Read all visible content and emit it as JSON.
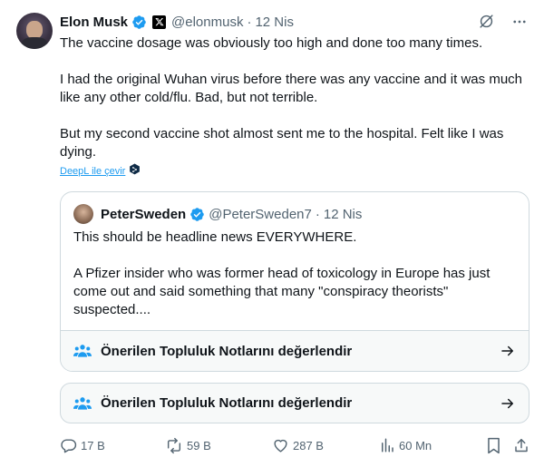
{
  "author": {
    "name": "Elon Musk",
    "handle": "@elonmusk",
    "separator": "·",
    "date": "12 Nis"
  },
  "tweet": {
    "paragraphs": [
      "The vaccine dosage was obviously too high and done too many times.",
      "I had the original Wuhan virus before there was any vaccine and it was much like any other cold/flu. Bad, but not terrible.",
      "But my second vaccine shot almost sent me to the hospital. Felt like I was dying."
    ],
    "translate_label": "DeepL ile çevir"
  },
  "quote": {
    "name": "PeterSweden",
    "handle": "@PeterSweden7",
    "separator": "·",
    "date": "12 Nis",
    "paragraphs": [
      "This should be headline news EVERYWHERE.",
      "A Pfizer insider who was former head of toxicology in Europe has just come out and said something that many \"conspiracy theorists\" suspected...."
    ],
    "notes_label": "Önerilen Topluluk Notlarını değerlendir"
  },
  "notes": {
    "label": "Önerilen Topluluk Notlarını değerlendir"
  },
  "actions": {
    "replies": "17 B",
    "reposts": "59 B",
    "likes": "287 B",
    "views": "60 Mn"
  },
  "icons": {
    "verified": "verified-badge-icon",
    "x_affiliate": "x-logo-icon",
    "grok": "grok-icon",
    "more": "more-icon",
    "notes": "community-notes-icon",
    "arrow": "arrow-right-icon",
    "reply": "reply-icon",
    "repost": "repost-icon",
    "like": "like-icon",
    "views": "views-icon",
    "bookmark": "bookmark-icon",
    "share": "share-icon"
  },
  "colors": {
    "accent": "#1d9bf0",
    "text": "#0f1419",
    "muted": "#536471",
    "border": "#cfd9de"
  }
}
